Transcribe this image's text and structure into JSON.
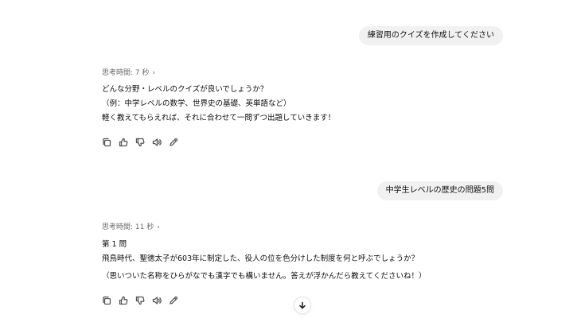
{
  "conversation": {
    "turns": [
      {
        "user_message": "練習用のクイズを作成してください",
        "thought_label": "思考時間: 7 秒",
        "reply_lines": [
          "どんな分野・レベルのクイズが良いでしょうか？",
          "（例：中学レベルの数学、世界史の基礎、英単語など）",
          "軽く教えてもらえれば、それに合わせて一問ずつ出題していきます！"
        ]
      },
      {
        "user_message": "中学生レベルの歴史の問題5問",
        "thought_label": "思考時間: 11 秒",
        "reply_lines": [
          "第 1 問",
          "飛鳥時代、聖徳太子が603年に制定した、役人の位を色分けした制度を何と呼ぶでしょうか？",
          "（思いついた名称をひらがなでも漢字でも構いません。答えが浮かんだら教えてくださいね！）"
        ]
      }
    ]
  },
  "icons": {
    "copy": "copy-icon",
    "thumbs_up": "thumbs-up-icon",
    "thumbs_down": "thumbs-down-icon",
    "read_aloud": "speaker-icon",
    "edit": "edit-icon",
    "scroll_down": "arrow-down-icon",
    "thought_expand": "chevron-right-icon"
  }
}
